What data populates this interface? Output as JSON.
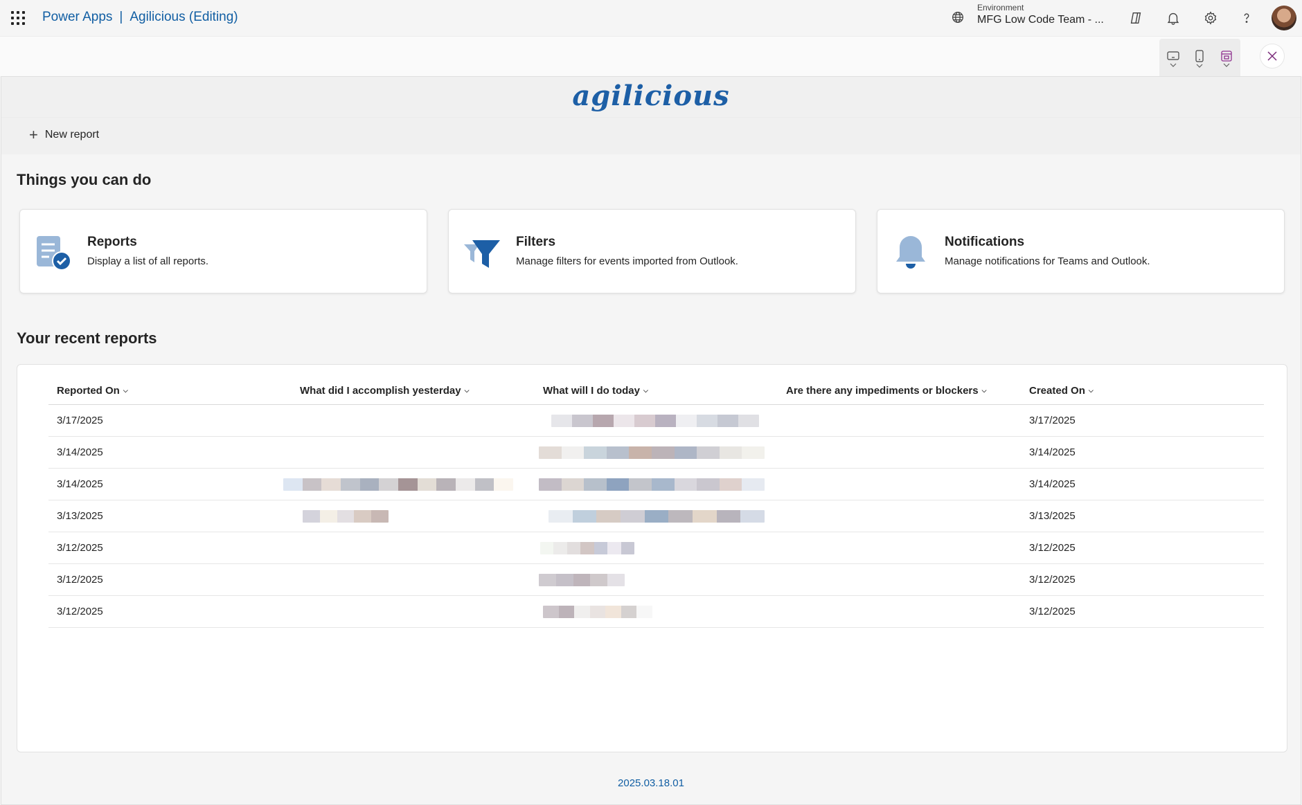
{
  "topbar": {
    "app_name": "Power Apps",
    "separator": "|",
    "app_title": "Agilicious (Editing)",
    "environment_label": "Environment",
    "environment_value": "MFG Low Code Team - ..."
  },
  "app": {
    "logo_text": "agilicious",
    "new_report_label": "New report",
    "things_title": "Things you can do",
    "cards": [
      {
        "title": "Reports",
        "description": "Display a list of all reports.",
        "icon": "reports-icon"
      },
      {
        "title": "Filters",
        "description": "Manage filters for events imported from Outlook.",
        "icon": "filter-icon"
      },
      {
        "title": "Notifications",
        "description": "Manage notifications for Teams and Outlook.",
        "icon": "bell-icon"
      }
    ],
    "recent_title": "Your recent reports",
    "table": {
      "headers": [
        "Reported On",
        "What did I accomplish yesterday",
        "What will I do today",
        "Are there any impediments or blockers",
        "Created On"
      ],
      "rows": [
        {
          "reported_on": "3/17/2025",
          "created_on": "3/17/2025"
        },
        {
          "reported_on": "3/14/2025",
          "created_on": "3/14/2025"
        },
        {
          "reported_on": "3/14/2025",
          "created_on": "3/14/2025"
        },
        {
          "reported_on": "3/13/2025",
          "created_on": "3/13/2025"
        },
        {
          "reported_on": "3/12/2025",
          "created_on": "3/12/2025"
        },
        {
          "reported_on": "3/12/2025",
          "created_on": "3/12/2025"
        },
        {
          "reported_on": "3/12/2025",
          "created_on": "3/12/2025"
        }
      ]
    },
    "version": "2025.03.18.01"
  },
  "colors": {
    "brand_blue": "#115ea3",
    "logo_blue": "#1d5fa6",
    "icon_blue": "#2f6fb5"
  }
}
